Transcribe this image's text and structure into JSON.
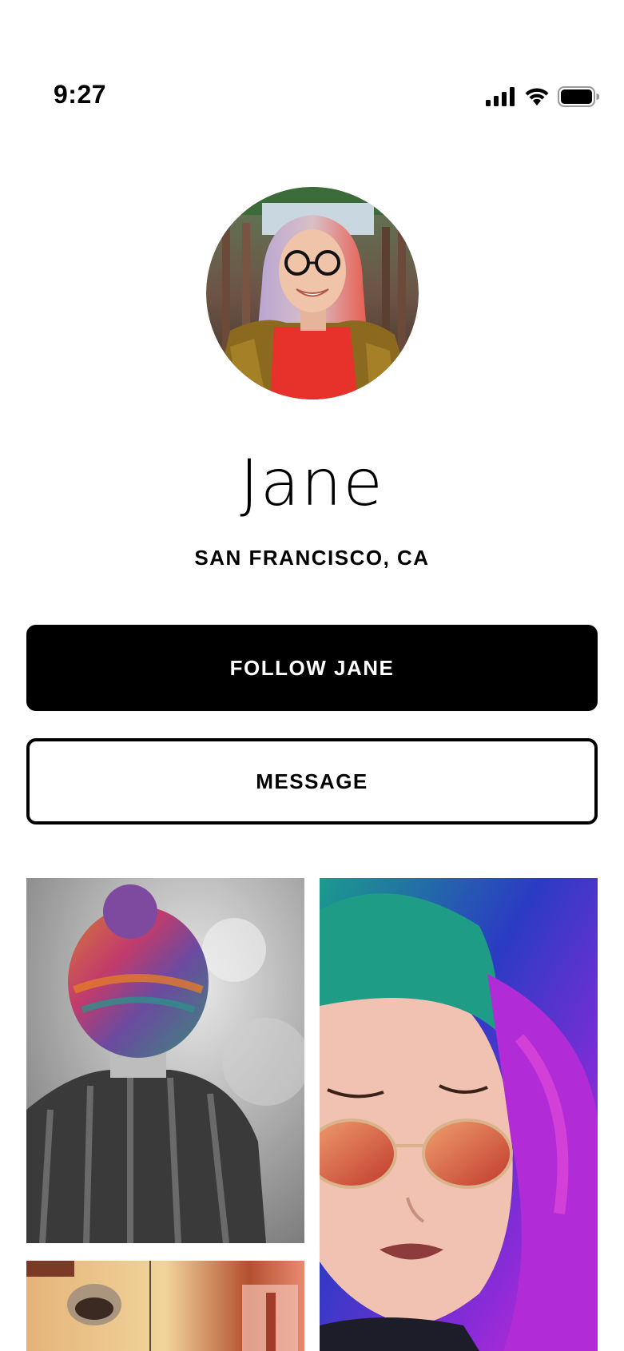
{
  "status_bar": {
    "time": "9:27",
    "icons": [
      "cellular-signal-icon",
      "wifi-icon",
      "battery-icon"
    ]
  },
  "profile": {
    "name": "Jane",
    "location": "SAN FRANCISCO, CA"
  },
  "actions": {
    "follow_label": "FOLLOW JANE",
    "message_label": "MESSAGE"
  },
  "colors": {
    "primary": "#000000",
    "background": "#ffffff",
    "on_primary": "#ffffff"
  }
}
